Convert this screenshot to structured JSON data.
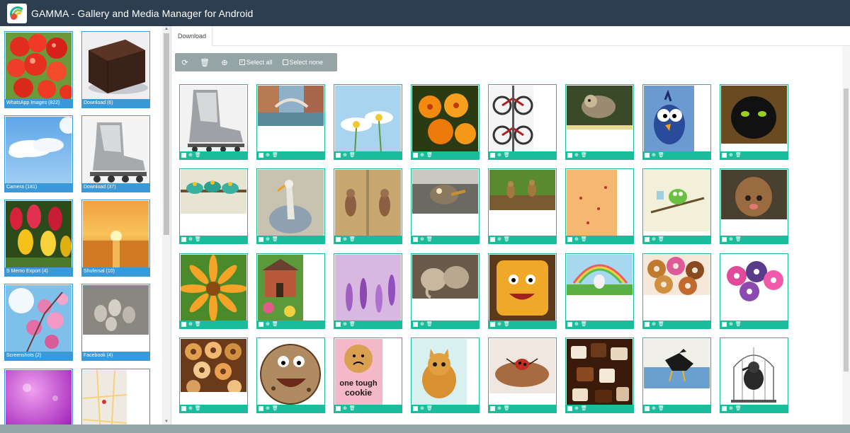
{
  "app": {
    "title": "GAMMA - Gallery and Media Manager for Android"
  },
  "sidebar": {
    "albums": [
      {
        "label": "WhatsApp Images (822)",
        "thumb": "red currants"
      },
      {
        "label": "Download (6)",
        "thumb": "chocolate cake"
      },
      {
        "label": "Camera (181)",
        "thumb": "blue sky clouds"
      },
      {
        "label": "Download (37)",
        "thumb": "inline skate"
      },
      {
        "label": "S Memo Export (4)",
        "thumb": "tulips"
      },
      {
        "label": "Shufersal (10)",
        "thumb": "sunset sea"
      },
      {
        "label": "Screenshots (2)",
        "thumb": "cherry blossom"
      },
      {
        "label": "Facebook (4)",
        "thumb": "owls"
      },
      {
        "label": "",
        "thumb": "purple bokeh"
      },
      {
        "label": "",
        "thumb": "map"
      }
    ]
  },
  "main": {
    "tab": "Download",
    "toolbar": {
      "refresh_icon": "refresh-icon",
      "trash_icon": "trash-icon",
      "download_icon": "download-icon",
      "select_all": "Select all",
      "select_none": "Select none"
    },
    "cards": [
      "inline skate",
      "venice canal",
      "white flowers",
      "orange flowers",
      "bicycles",
      "sloth",
      "blue bird",
      "black cat",
      "caterpillars",
      "pelican",
      "meerkats",
      "bird close-up",
      "ground squirrels",
      "red dots",
      "green bird",
      "furry creature",
      "yellow flower",
      "cottage",
      "lavender",
      "elephants",
      "cracker face",
      "rainbow bunny",
      "donuts",
      "pink donuts",
      "donuts pile",
      "cookie face",
      "one tough cookie",
      "cartoon cat",
      "ladybug",
      "chocolates",
      "crow",
      "bird cage"
    ]
  }
}
